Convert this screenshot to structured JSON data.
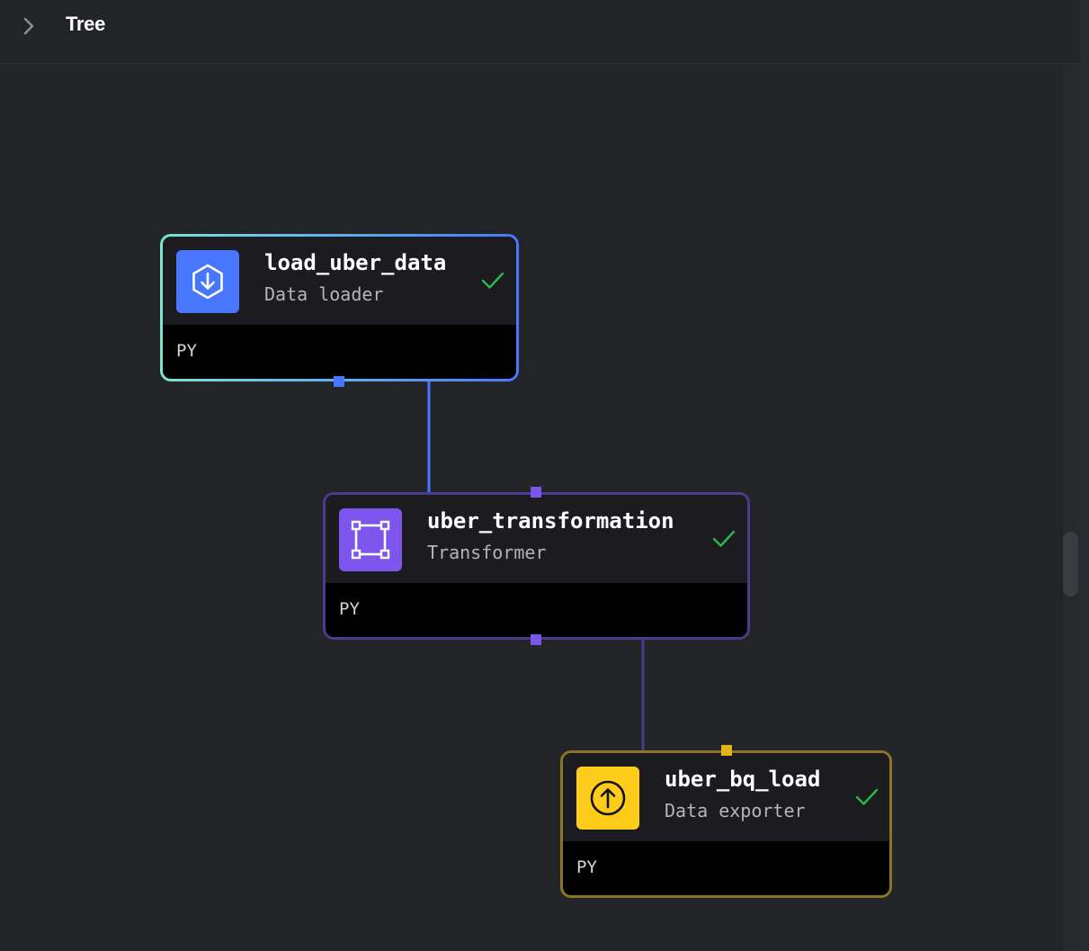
{
  "header": {
    "title": "Tree",
    "toggle_icon": "chevron-right-icon"
  },
  "colors": {
    "background": "#232428",
    "data_loader": "#4877ff",
    "transformer": "#7d55ec",
    "exporter": "#ffcc19",
    "status_success": "#2ab849",
    "edge_loader": "#4877ff",
    "edge_transformer": "#4c3a8c"
  },
  "blocks": [
    {
      "name": "load_uber_data",
      "type": "Data loader",
      "language": "PY",
      "icon": "download-icon",
      "status_icon": "check-icon"
    },
    {
      "name": "uber_transformation",
      "type": "Transformer",
      "language": "PY",
      "icon": "transform-icon",
      "status_icon": "check-icon"
    },
    {
      "name": "uber_bq_load",
      "type": "Data exporter",
      "language": "PY",
      "icon": "upload-icon",
      "status_icon": "check-icon"
    }
  ]
}
